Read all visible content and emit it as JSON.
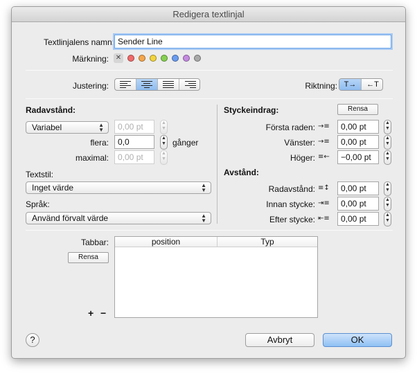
{
  "window": {
    "title": "Redigera textlinjal"
  },
  "name": {
    "label": "Textlinjalens namn:",
    "value": "Sender Line"
  },
  "marking": {
    "label": "Märkning:",
    "clear_icon": "✕",
    "colors": [
      "#f06a6a",
      "#f5a64c",
      "#f2d43f",
      "#86cf4f",
      "#6a9cf0",
      "#c48ae0",
      "#a9a9a9"
    ]
  },
  "justify": {
    "label": "Justering:",
    "options": [
      "left",
      "center",
      "justify",
      "right"
    ],
    "selected": 1
  },
  "direction": {
    "label": "Riktning:",
    "options": [
      "T→",
      "←T"
    ],
    "selected": 0
  },
  "line_spacing": {
    "header": "Radavstånd:",
    "mode": "Variabel",
    "value1": "0,00 pt",
    "multiple_label": "flera:",
    "multiple_value": "0,0",
    "times_label": "gånger",
    "max_label": "maximal:",
    "max_value": "0,00 pt"
  },
  "text_style": {
    "label": "Textstil:",
    "value": "Inget värde"
  },
  "language": {
    "label": "Språk:",
    "value": "Använd förvalt värde"
  },
  "indent": {
    "header": "Styckeindrag:",
    "clear_label": "Rensa",
    "first_label": "Första raden:",
    "first_value": "0,00 pt",
    "left_label": "Vänster:",
    "left_value": "0,00 pt",
    "right_label": "Höger:",
    "right_value": "−0,00 pt"
  },
  "spacing": {
    "header": "Avstånd:",
    "line_label": "Radavstånd:",
    "line_value": "0,00 pt",
    "before_label": "Innan stycke:",
    "before_value": "0,00 pt",
    "after_label": "Efter stycke:",
    "after_value": "0,00 pt"
  },
  "tabs": {
    "label": "Tabbar:",
    "clear_label": "Rensa",
    "col_position": "position",
    "col_type": "Typ",
    "add": "+",
    "remove": "−"
  },
  "footer": {
    "help": "?",
    "cancel": "Avbryt",
    "ok": "OK"
  }
}
